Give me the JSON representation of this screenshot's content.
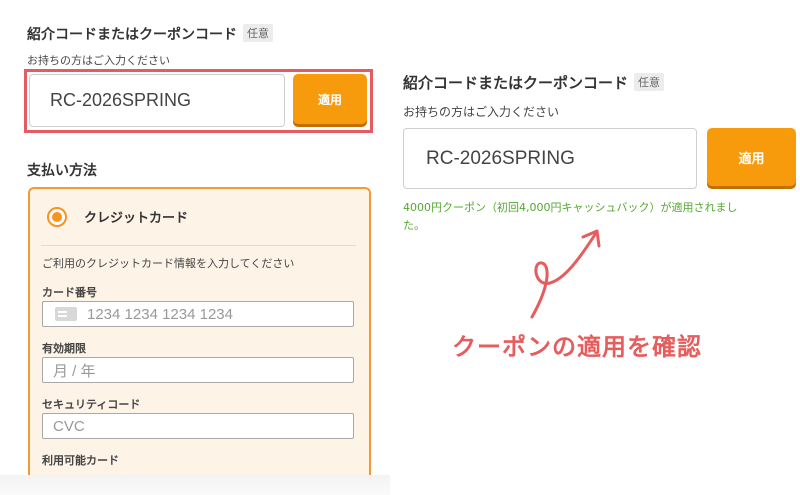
{
  "coupon": {
    "title": "紹介コードまたはクーポンコード",
    "badge": "任意",
    "hint": "お持ちの方はご入力ください",
    "code_value": "RC-2026SPRING",
    "apply_label": "適用",
    "success_message": "4000円クーポン（初回4,000円キャッシュバック）が適用されました。"
  },
  "payment": {
    "title": "支払い方法",
    "method_label": "クレジットカード",
    "description": "ご利用のクレジットカード情報を入力してください",
    "card_number_label": "カード番号",
    "card_number_placeholder": "1234 1234 1234 1234",
    "expiry_label": "有効期限",
    "expiry_placeholder": "月 / 年",
    "cvc_label": "セキュリティコード",
    "cvc_placeholder": "CVC",
    "brands_label": "利用可能カード"
  },
  "annotation": {
    "text": "クーポンの適用を確認"
  },
  "colors": {
    "accent_orange": "#f79a0b",
    "highlight_red": "#e55b63",
    "success_green": "#56a832",
    "annotation_red": "#e65d5d",
    "pay_box_bg": "#fdf3e7"
  },
  "icons": [
    "radio-selected-icon",
    "credit-card-icon",
    "curly-arrow-icon"
  ]
}
